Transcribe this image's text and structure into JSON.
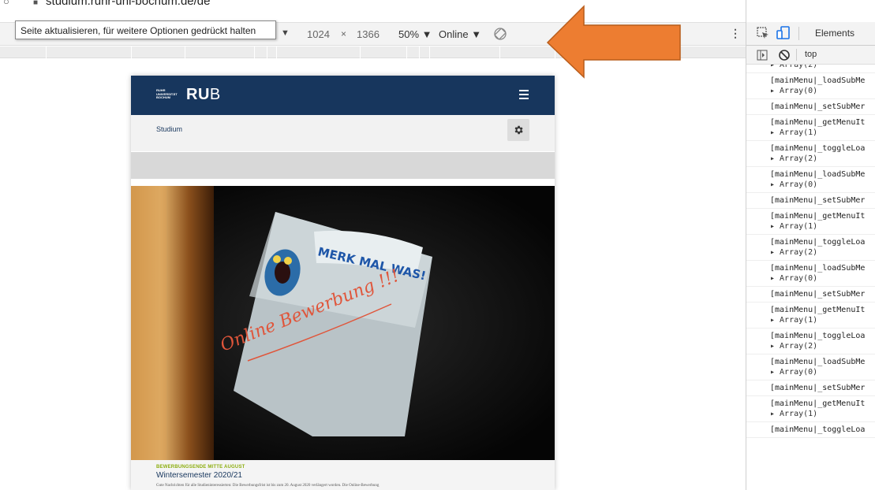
{
  "address_bar": {
    "url": "studium.ruhr-uni-bochum.de/de"
  },
  "tooltip": {
    "text": "Seite aktualisieren, für weitere Optionen gedrückt halten"
  },
  "device_toolbar": {
    "width": "1024",
    "times": "×",
    "height": "1366",
    "zoom": "50% ▼",
    "network": "Online ▼",
    "device_caret": "▼"
  },
  "devtools": {
    "panel_tab": "Elements",
    "context": "top",
    "log": [
      {
        "msg": "",
        "detail": "▸ Array(2)"
      },
      {
        "msg": "[mainMenu|_loadSubMe",
        "detail": "▸ Array(0)"
      },
      {
        "msg": "[mainMenu|_setSubMer",
        "detail": ""
      },
      {
        "msg": "[mainMenu|_getMenuIt",
        "detail": "▸ Array(1)"
      },
      {
        "msg": "[mainMenu|_toggleLoa",
        "detail": "▸ Array(2)"
      },
      {
        "msg": "[mainMenu|_loadSubMe",
        "detail": "▸ Array(0)"
      },
      {
        "msg": "[mainMenu|_setSubMer",
        "detail": ""
      },
      {
        "msg": "[mainMenu|_getMenuIt",
        "detail": "▸ Array(1)"
      },
      {
        "msg": "[mainMenu|_toggleLoa",
        "detail": "▸ Array(2)"
      },
      {
        "msg": "[mainMenu|_loadSubMe",
        "detail": "▸ Array(0)"
      },
      {
        "msg": "[mainMenu|_setSubMer",
        "detail": ""
      },
      {
        "msg": "[mainMenu|_getMenuIt",
        "detail": "▸ Array(1)"
      },
      {
        "msg": "[mainMenu|_toggleLoa",
        "detail": "▸ Array(2)"
      },
      {
        "msg": "[mainMenu|_loadSubMe",
        "detail": "▸ Array(0)"
      },
      {
        "msg": "[mainMenu|_setSubMer",
        "detail": ""
      },
      {
        "msg": "[mainMenu|_getMenuIt",
        "detail": "▸ Array(1)"
      },
      {
        "msg": "[mainMenu|_toggleLoa",
        "detail": ""
      }
    ]
  },
  "site": {
    "logo_small": [
      "RUHR",
      "UNIVERSITÄT",
      "BOCHUM"
    ],
    "logo_bold": "RU",
    "logo_regular": "B",
    "breadcrumb": "Studium",
    "hero_note_header": "MERK MAL WAS!",
    "hero_note_text": "Online Bewerbung !!!",
    "teaser_kicker": "BEWERBUNGSENDE MITTE AUGUST",
    "teaser_title": "Wintersemester 2020/21",
    "teaser_text": "Gute Nachrichten für alle Studieninteressierten: Die Bewerbungsfrist ist bis zum 20. August 2020 verlängert worden. Die Online-Bewerbung"
  },
  "colors": {
    "rub_blue": "#17365d",
    "rub_green": "#8dae10",
    "arrow_orange": "#ed7d31"
  }
}
